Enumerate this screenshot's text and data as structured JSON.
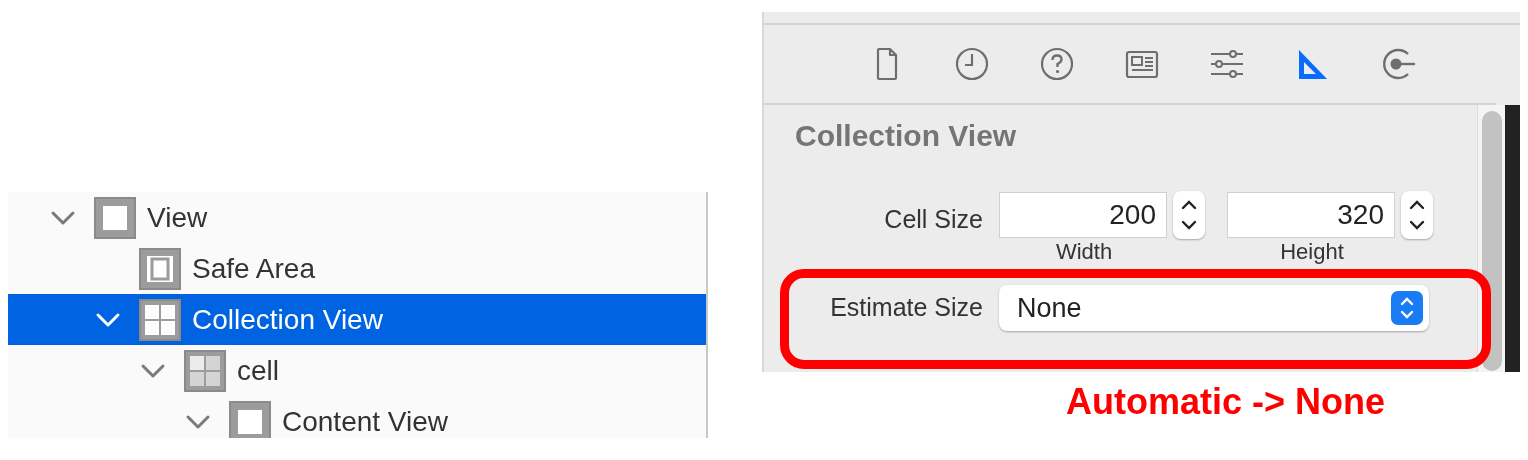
{
  "outline": {
    "items": [
      {
        "label": "View",
        "kind": "view",
        "expanded": true,
        "selected": false,
        "children": [
          {
            "label": "Safe Area",
            "kind": "safe-area",
            "selected": false
          },
          {
            "label": "Collection View",
            "kind": "collection",
            "expanded": true,
            "selected": true,
            "children": [
              {
                "label": "cell",
                "kind": "cell",
                "expanded": true,
                "selected": false,
                "children": [
                  {
                    "label": "Content View",
                    "kind": "view",
                    "expanded": true,
                    "selected": false
                  }
                ]
              }
            ]
          }
        ]
      }
    ]
  },
  "inspector": {
    "tabs": [
      {
        "kind": "file",
        "selected": false
      },
      {
        "kind": "clock",
        "selected": false
      },
      {
        "kind": "help",
        "selected": false
      },
      {
        "kind": "identity",
        "selected": false
      },
      {
        "kind": "sliders",
        "selected": false
      },
      {
        "kind": "ruler",
        "selected": true
      },
      {
        "kind": "connections",
        "selected": false
      }
    ],
    "section_title": "Collection View",
    "cell_size": {
      "label": "Cell Size",
      "fields": [
        {
          "value": "200",
          "caption": "Width"
        },
        {
          "value": "320",
          "caption": "Height"
        }
      ]
    },
    "estimate_size": {
      "label": "Estimate Size",
      "value": "None"
    }
  },
  "annotation": {
    "text": "Automatic -> None"
  }
}
